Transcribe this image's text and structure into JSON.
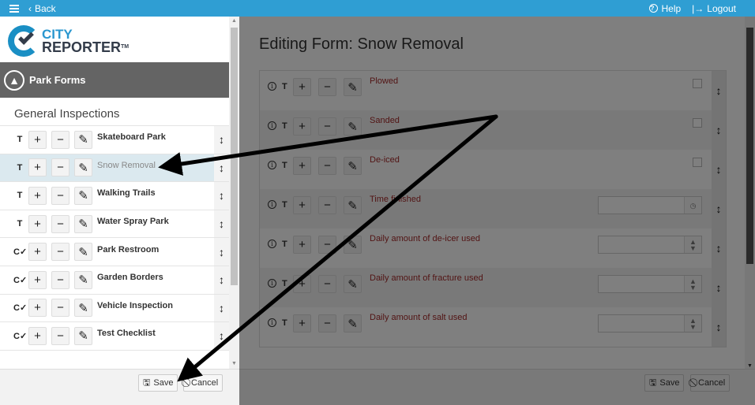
{
  "topbar": {
    "back_label": "Back",
    "help_label": "Help",
    "logout_label": "Logout"
  },
  "brand": {
    "line1": "CITY",
    "line2": "REPORTER",
    "tm": "TM"
  },
  "sidebar": {
    "section_title": "Park Forms",
    "group_title": "General Inspections",
    "items": [
      {
        "type": "T",
        "label": "Skateboard Park",
        "active": false
      },
      {
        "type": "T",
        "label": "Snow Removal",
        "active": true
      },
      {
        "type": "T",
        "label": "Walking Trails",
        "active": false
      },
      {
        "type": "T",
        "label": "Water Spray Park",
        "active": false
      },
      {
        "type": "C✓",
        "label": "Park Restroom",
        "active": false
      },
      {
        "type": "C✓",
        "label": "Garden Borders",
        "active": false
      },
      {
        "type": "C✓",
        "label": "Vehicle Inspection",
        "active": false
      },
      {
        "type": "C✓",
        "label": "Test Checklist",
        "active": false
      }
    ],
    "save_label": "Save",
    "cancel_label": "Cancel"
  },
  "main": {
    "title": "Editing Form: Snow Removal",
    "fields": [
      {
        "type": "T",
        "label": "Plowed",
        "control": "checkbox"
      },
      {
        "type": "T",
        "label": "Sanded",
        "control": "checkbox"
      },
      {
        "type": "T",
        "label": "De-iced",
        "control": "checkbox"
      },
      {
        "type": "T",
        "label": "Time finished",
        "control": "time"
      },
      {
        "type": "T",
        "label": "Daily amount of de-icer used",
        "control": "number"
      },
      {
        "type": "T",
        "label": "Daily amount of fracture used",
        "control": "number"
      },
      {
        "type": "T",
        "label": "Daily amount of salt used",
        "control": "number"
      }
    ],
    "save_label": "Save",
    "cancel_label": "Cancel"
  },
  "colors": {
    "topbar": "#2f9ed3",
    "section_header": "#646464",
    "field_label": "#a52a2a",
    "active_row": "#dbe9ef"
  }
}
